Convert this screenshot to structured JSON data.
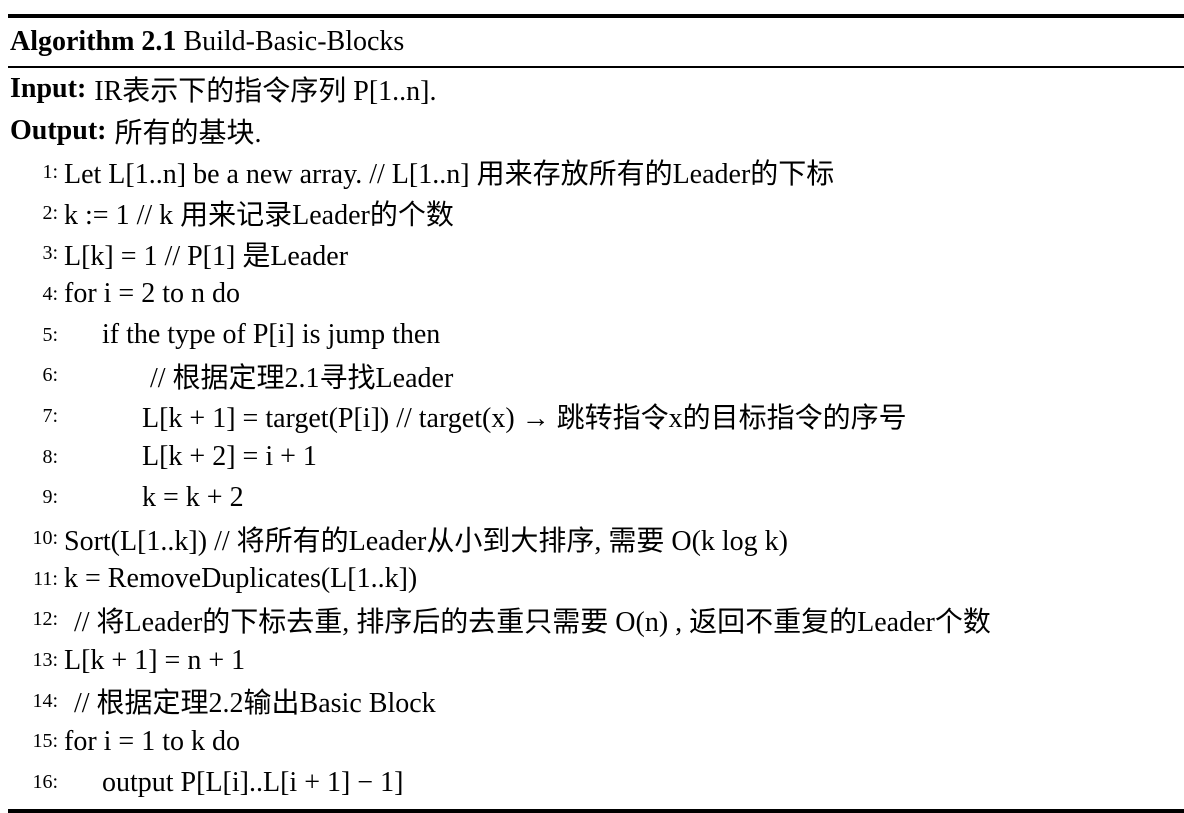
{
  "algorithm": {
    "label": "Algorithm 2.1",
    "title": "Build-Basic-Blocks"
  },
  "input": {
    "label": "Input:",
    "text": "IR表示下的指令序列 P[1..n]."
  },
  "output": {
    "label": "Output:",
    "text": "所有的基块."
  },
  "lines": [
    {
      "num": "1:",
      "text": "Let L[1..n] be a new array. // L[1..n] 用来存放所有的Leader的下标"
    },
    {
      "num": "2:",
      "text": "k := 1 // k 用来记录Leader的个数"
    },
    {
      "num": "3:",
      "text": "L[k] = 1 // P[1] 是Leader"
    },
    {
      "num": "4:",
      "text": "for i = 2 to n do"
    },
    {
      "num": "5:",
      "text": "if the type of P[i] is jump then"
    },
    {
      "num": "6:",
      "text": "// 根据定理2.1寻找Leader"
    },
    {
      "num": "7:",
      "text": "L[k + 1] = target(P[i]) // target(x) → 跳转指令x的目标指令的序号"
    },
    {
      "num": "8:",
      "text": "L[k + 2] = i + 1"
    },
    {
      "num": "9:",
      "text": "k = k + 2"
    },
    {
      "num": "10:",
      "text": "Sort(L[1..k]) // 将所有的Leader从小到大排序, 需要 O(k log k)"
    },
    {
      "num": "11:",
      "text": "k = RemoveDuplicates(L[1..k])"
    },
    {
      "num": "12:",
      "text": "// 将Leader的下标去重, 排序后的去重只需要 O(n) , 返回不重复的Leader个数"
    },
    {
      "num": "13:",
      "text": "L[k + 1] = n + 1"
    },
    {
      "num": "14:",
      "text": "// 根据定理2.2输出Basic Block"
    },
    {
      "num": "15:",
      "text": "for i = 1 to k do"
    },
    {
      "num": "16:",
      "text": "output P[L[i]..L[i + 1] − 1]"
    }
  ]
}
